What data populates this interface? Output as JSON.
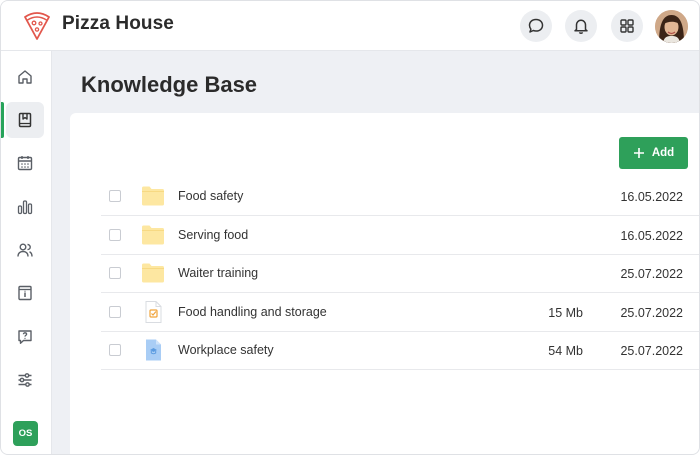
{
  "app": {
    "title": "Pizza House",
    "logo_icon": "pizza-slice-icon",
    "accent_color": "#2ea05a"
  },
  "header": {
    "actions": [
      {
        "icon": "chat-bubble-icon"
      },
      {
        "icon": "bell-icon"
      },
      {
        "icon": "apps-grid-icon"
      }
    ],
    "avatar": "user-avatar"
  },
  "sidebar": {
    "items": [
      {
        "icon": "home-icon",
        "active": false
      },
      {
        "icon": "book-icon",
        "active": true
      },
      {
        "icon": "calendar-icon",
        "active": false
      },
      {
        "icon": "bar-chart-icon",
        "active": false
      },
      {
        "icon": "users-icon",
        "active": false
      },
      {
        "icon": "info-box-icon",
        "active": false
      },
      {
        "icon": "help-chat-icon",
        "active": false
      },
      {
        "icon": "sliders-icon",
        "active": false
      }
    ],
    "user_initials": "OS"
  },
  "main": {
    "page_title": "Knowledge Base",
    "add_label": "Add",
    "files": [
      {
        "type": "folder",
        "name": "Food safety",
        "size": "",
        "date": "16.05.2022"
      },
      {
        "type": "folder",
        "name": "Serving food",
        "size": "",
        "date": "16.05.2022"
      },
      {
        "type": "folder",
        "name": "Waiter training",
        "size": "",
        "date": "25.07.2022"
      },
      {
        "type": "checklist-document",
        "name": "Food handling and storage",
        "size": "15 Mb",
        "date": "25.07.2022"
      },
      {
        "type": "course-document",
        "name": "Workplace safety",
        "size": "54 Mb",
        "date": "25.07.2022"
      }
    ]
  }
}
